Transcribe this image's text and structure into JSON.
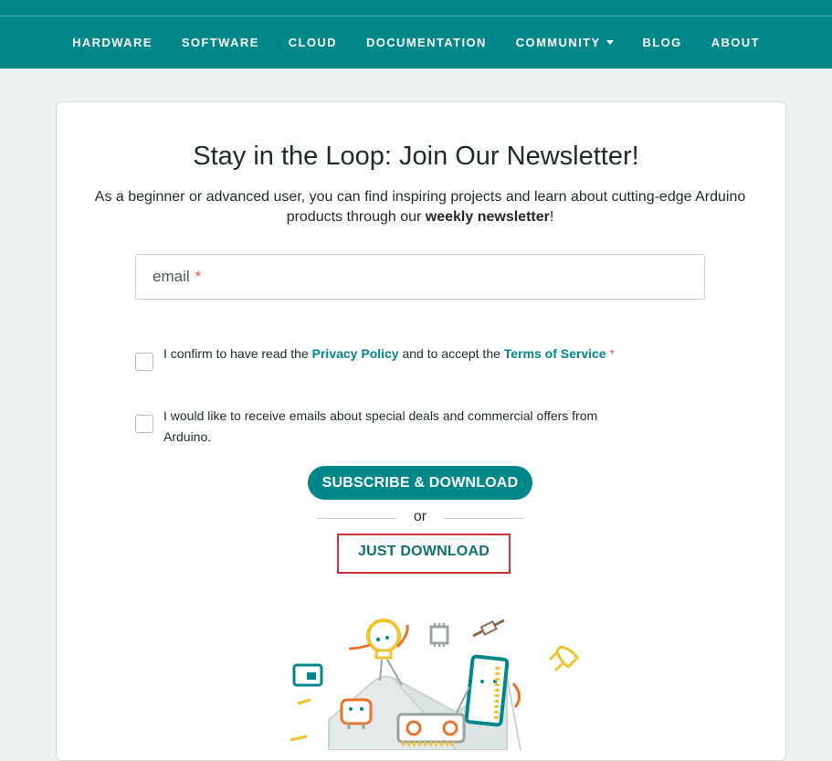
{
  "nav": {
    "items": [
      {
        "label": "HARDWARE"
      },
      {
        "label": "SOFTWARE"
      },
      {
        "label": "CLOUD"
      },
      {
        "label": "DOCUMENTATION"
      },
      {
        "label": "COMMUNITY"
      },
      {
        "label": "BLOG"
      },
      {
        "label": "ABOUT"
      }
    ],
    "background": "#00878A"
  },
  "newsletter": {
    "title": "Stay in the Loop: Join Our Newsletter!",
    "intro_prefix": "As a beginner or advanced user, you can find inspiring projects and learn about cutting-edge Arduino products through our ",
    "intro_bold": "weekly newsletter",
    "intro_suffix": "!",
    "email_placeholder": "email",
    "required_mark": "*",
    "privacy": {
      "text1": "I confirm to have read the ",
      "link1": "Privacy Policy",
      "text2": " and to accept the ",
      "link2": "Terms of Service"
    },
    "offers_text": "I would like to receive emails about special deals and commercial offers from Arduino.",
    "subscribe_label": "SUBSCRIBE & DOWNLOAD",
    "or_label": "or",
    "just_download_label": "JUST DOWNLOAD"
  },
  "colors": {
    "accent": "#00878A",
    "required": "#DA5B4A",
    "highlight_border": "#D0303A",
    "page_bg": "#ECF1F1"
  }
}
